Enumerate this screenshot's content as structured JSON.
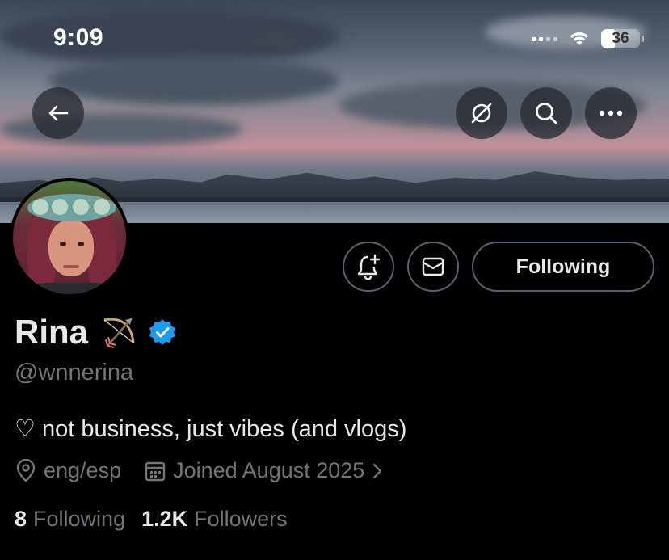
{
  "status_bar": {
    "time": "9:09",
    "battery_level": "36",
    "battery_fraction": 0.36
  },
  "header": {
    "back_icon": "arrow-left-icon",
    "grok_icon": "grok-icon",
    "search_icon": "search-icon",
    "more_icon": "more-horizontal-icon"
  },
  "profile": {
    "display_name": "Rina",
    "name_emoji": "🏹",
    "verified": true,
    "handle": "@wnnerina",
    "bio": "♡ not business, just vibes (and vlogs)",
    "location": "eng/esp",
    "joined": "Joined August 2025",
    "following_count": "8",
    "following_label": "Following",
    "followers_count": "1.2K",
    "followers_label": "Followers"
  },
  "actions": {
    "notify_icon": "bell-plus-icon",
    "message_icon": "envelope-icon",
    "follow_state_label": "Following"
  },
  "colors": {
    "background": "#000000",
    "primary_text": "#e7e9ea",
    "secondary_text": "#71767b",
    "border": "#536471",
    "verified_blue": "#1d9bf0"
  }
}
